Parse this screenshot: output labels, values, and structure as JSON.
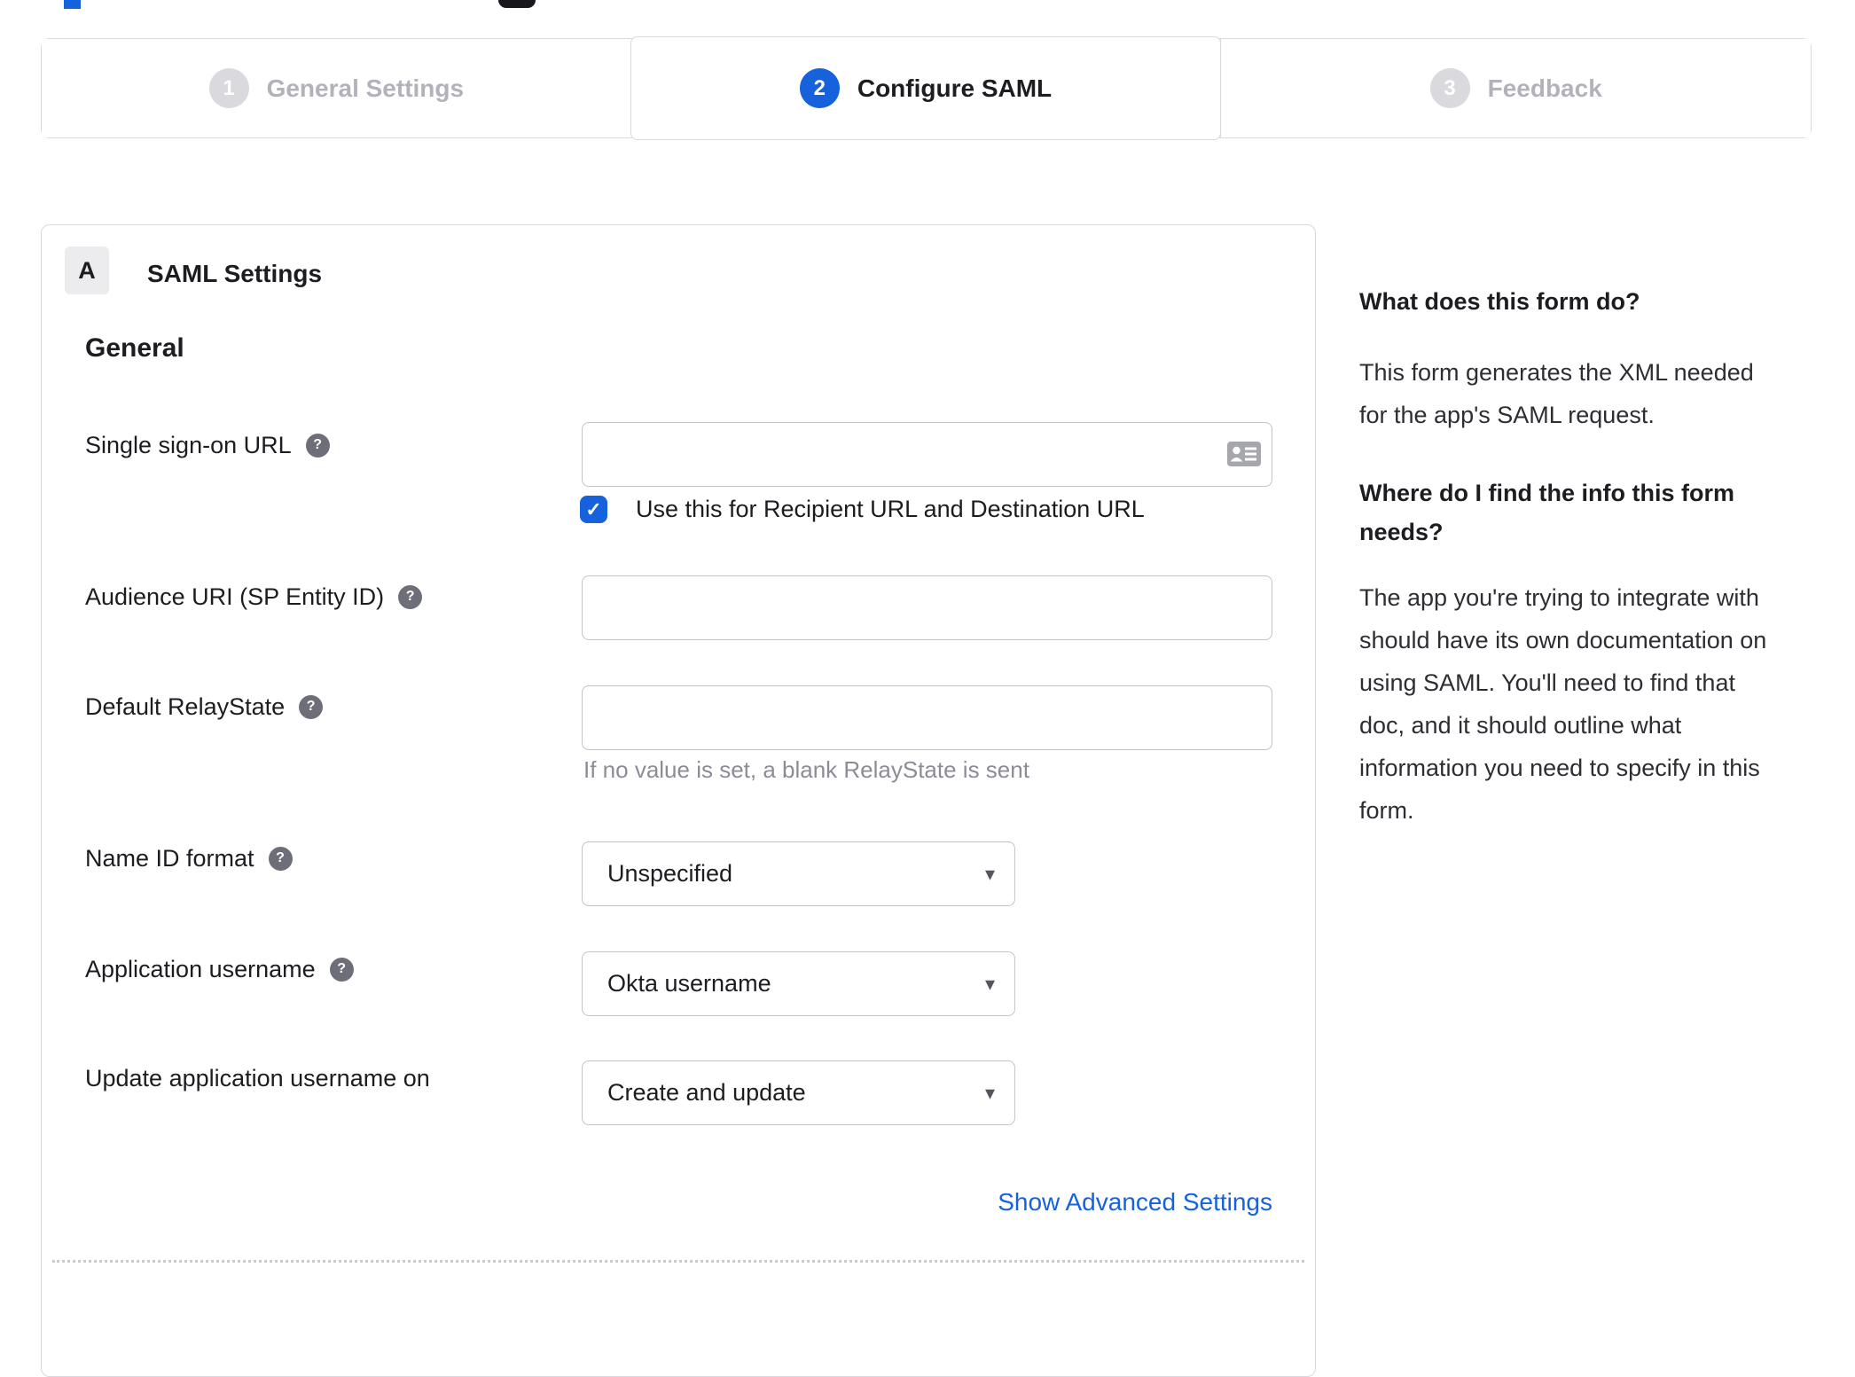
{
  "stepper": {
    "steps": [
      {
        "number": "1",
        "label": "General Settings",
        "active": false
      },
      {
        "number": "2",
        "label": "Configure SAML",
        "active": true
      },
      {
        "number": "3",
        "label": "Feedback",
        "active": false
      }
    ]
  },
  "form": {
    "section_letter": "A",
    "section_title": "SAML Settings",
    "group_heading": "General",
    "sso_label": "Single sign-on URL",
    "sso_value": "",
    "sso_checkbox_label": "Use this for Recipient URL and Destination URL",
    "sso_checkbox_checked": true,
    "audience_label": "Audience URI (SP Entity ID)",
    "audience_value": "",
    "relay_label": "Default RelayState",
    "relay_value": "",
    "relay_helper": "If no value is set, a blank RelayState is sent",
    "name_id_label": "Name ID format",
    "name_id_value": "Unspecified",
    "app_username_label": "Application username",
    "app_username_value": "Okta username",
    "update_username_label": "Update application username on",
    "update_username_value": "Create and update",
    "advanced_link_label": "Show Advanced Settings"
  },
  "sidebar": {
    "q1_title": "What does this form do?",
    "q1_lines": [
      "This form generates the XML needed",
      "for the app's SAML request."
    ],
    "q2_title_lines": [
      "Where do I find the info this form",
      "needs?"
    ],
    "q2_lines": [
      "The app you're trying to integrate with",
      "should have its own documentation on",
      "using SAML. You'll need to find that",
      "doc, and it should outline what",
      "information you need to specify in this",
      "form."
    ]
  },
  "icons": {
    "help": "?",
    "checkmark": "✓",
    "caret": "▾"
  },
  "colors": {
    "accent_blue": "#1662dd",
    "border_gray": "#d9d9de",
    "inactive_gray": "#b2b2ba",
    "text_dark": "#1d1d21",
    "helper_gray": "#8c8c96"
  }
}
